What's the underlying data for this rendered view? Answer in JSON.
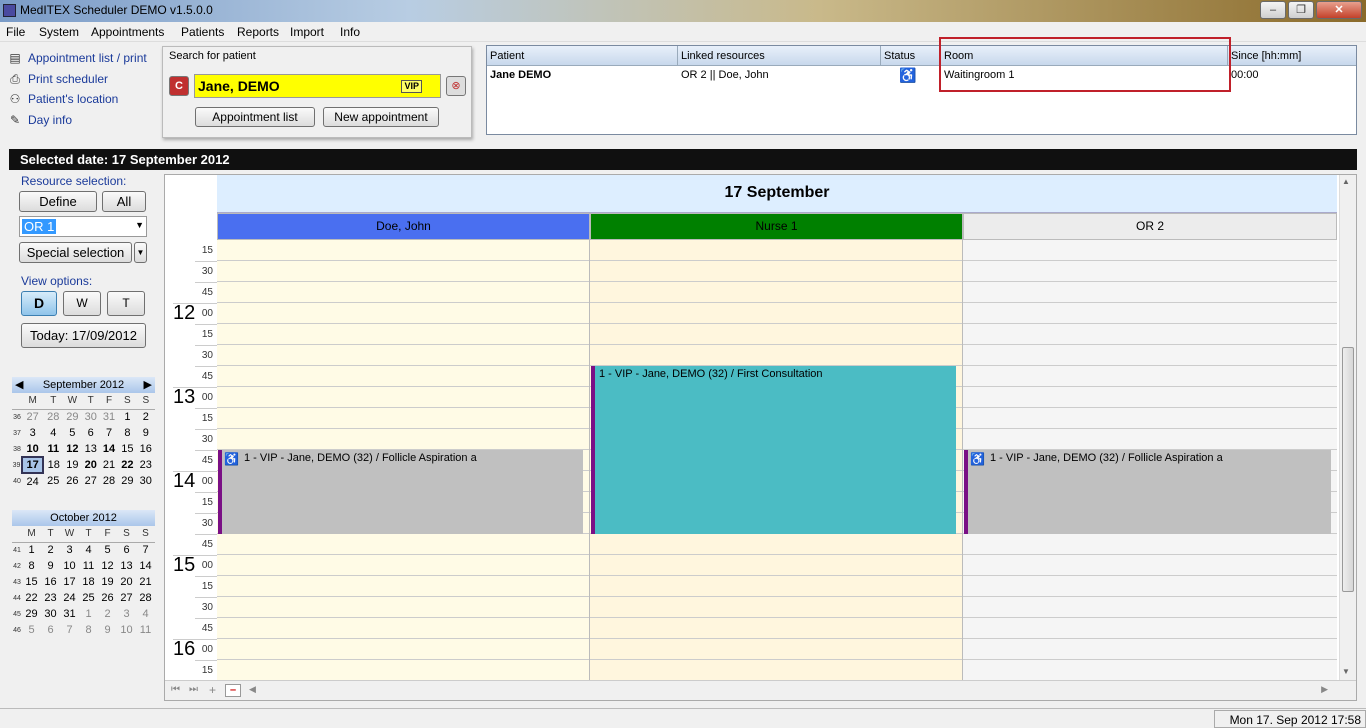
{
  "window": {
    "title": "MedITEX  Scheduler DEMO v1.5.0.0",
    "min": "–",
    "max": "❐",
    "close": "✕"
  },
  "menu": [
    "File",
    "System",
    "Appointments",
    "Patients",
    "Reports",
    "Import",
    "Info"
  ],
  "top_links": [
    {
      "label": "Appointment list / print",
      "icon": "list-icon"
    },
    {
      "label": "Print scheduler",
      "icon": "printer-icon"
    },
    {
      "label": "Patient's location",
      "icon": "location-icon"
    },
    {
      "label": "Day info",
      "icon": "note-icon"
    }
  ],
  "search": {
    "label": "Search for patient",
    "value": "Jane, DEMO",
    "vip": "VIP",
    "appointment_list": "Appointment list",
    "new_appointment": "New appointment"
  },
  "patient_grid": {
    "headers": [
      "Patient",
      "Linked resources",
      "Status",
      "Room",
      "Since [hh:mm]"
    ],
    "row": {
      "patient": "Jane DEMO",
      "resources": "OR 2 || Doe, John",
      "room": "Waitingroom 1",
      "since": "00:00"
    }
  },
  "selected_date": "Selected date: 17 September 2012",
  "left": {
    "resource_selection": "Resource selection:",
    "define": "Define",
    "all": "All",
    "resource_value": "OR 1",
    "special_selection": "Special selection",
    "view_options": "View options:",
    "view_d": "D",
    "view_w": "W",
    "view_t": "T",
    "today": "Today:  17/09/2012"
  },
  "cal_sep": {
    "title": "September 2012",
    "dow": [
      "M",
      "T",
      "W",
      "T",
      "F",
      "S",
      "S"
    ],
    "weeks": [
      {
        "wk": "36",
        "days": [
          "27",
          "28",
          "29",
          "30",
          "31",
          "1",
          "2"
        ]
      },
      {
        "wk": "37",
        "days": [
          "3",
          "4",
          "5",
          "6",
          "7",
          "8",
          "9"
        ]
      },
      {
        "wk": "38",
        "days": [
          "10",
          "11",
          "12",
          "13",
          "14",
          "15",
          "16"
        ]
      },
      {
        "wk": "39",
        "days": [
          "17",
          "18",
          "19",
          "20",
          "21",
          "22",
          "23"
        ]
      },
      {
        "wk": "40",
        "days": [
          "24",
          "25",
          "26",
          "27",
          "28",
          "29",
          "30"
        ]
      }
    ]
  },
  "cal_oct": {
    "title": "October 2012",
    "dow": [
      "M",
      "T",
      "W",
      "T",
      "F",
      "S",
      "S"
    ],
    "weeks": [
      {
        "wk": "41",
        "days": [
          "1",
          "2",
          "3",
          "4",
          "5",
          "6",
          "7"
        ]
      },
      {
        "wk": "42",
        "days": [
          "8",
          "9",
          "10",
          "11",
          "12",
          "13",
          "14"
        ]
      },
      {
        "wk": "43",
        "days": [
          "15",
          "16",
          "17",
          "18",
          "19",
          "20",
          "21"
        ]
      },
      {
        "wk": "44",
        "days": [
          "22",
          "23",
          "24",
          "25",
          "26",
          "27",
          "28"
        ]
      },
      {
        "wk": "45",
        "days": [
          "29",
          "30",
          "31",
          "1",
          "2",
          "3",
          "4"
        ]
      },
      {
        "wk": "46",
        "days": [
          "5",
          "6",
          "7",
          "8",
          "9",
          "10",
          "11"
        ]
      }
    ]
  },
  "schedule": {
    "day_title": "17 September",
    "resources": [
      {
        "name": "Doe, John",
        "color": "#4a6ff0"
      },
      {
        "name": "Nurse 1",
        "color": "#008000"
      },
      {
        "name": "OR 2",
        "color": "#ececec"
      }
    ],
    "ticks": [
      "15",
      "30",
      "45",
      "00",
      "15",
      "30",
      "45",
      "00",
      "15",
      "30",
      "45",
      "00",
      "15",
      "30",
      "45",
      "00",
      "15",
      "30",
      "45",
      "00",
      "15"
    ],
    "hours": [
      "12",
      "13",
      "14",
      "15",
      "16"
    ],
    "appointments": [
      {
        "text": "1 - VIP - Jane, DEMO (32) / Follicle Aspiration a",
        "resource": 0,
        "start_time": "13:45",
        "end_time": "14:45",
        "color": "#c0c0c0",
        "status_icon": true
      },
      {
        "text": "1 - VIP - Jane, DEMO (32) / First Consultation",
        "resource": 1,
        "start_time": "12:45",
        "end_time": "14:45",
        "color": "#4bbcc4",
        "status_icon": false
      },
      {
        "text": "1 - VIP - Jane, DEMO (32) / Follicle Aspiration a",
        "resource": 2,
        "start_time": "13:45",
        "end_time": "14:45",
        "color": "#c0c0c0",
        "status_icon": true
      }
    ]
  },
  "status": {
    "clock": "Mon 17. Sep 2012 17:58"
  }
}
